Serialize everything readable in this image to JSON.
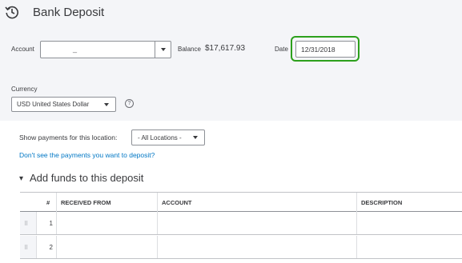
{
  "header": {
    "title": "Bank Deposit",
    "icon": "history-icon"
  },
  "form": {
    "account_label": "Account",
    "account_value": "_",
    "balance_label": "Balance",
    "balance_value": "$17,617.93",
    "date_label": "Date",
    "date_value": "12/31/2018",
    "currency_label": "Currency",
    "currency_value": "USD United States Dollar",
    "help_glyph": "?"
  },
  "payments": {
    "location_label": "Show payments for this location:",
    "location_value": "- All Locations -",
    "link_text": "Don't see the payments you want to deposit?"
  },
  "funds": {
    "toggle_glyph": "▾",
    "title": "Add funds to this deposit",
    "columns": [
      "#",
      "RECEIVED FROM",
      "ACCOUNT",
      "DESCRIPTION"
    ],
    "rows": [
      {
        "num": "1",
        "grip": "⠿"
      },
      {
        "num": "2",
        "grip": "⠿"
      }
    ]
  },
  "colors": {
    "highlight": "#2ca01c",
    "link": "#0077c5",
    "panel_bg": "#f4f5f8"
  }
}
